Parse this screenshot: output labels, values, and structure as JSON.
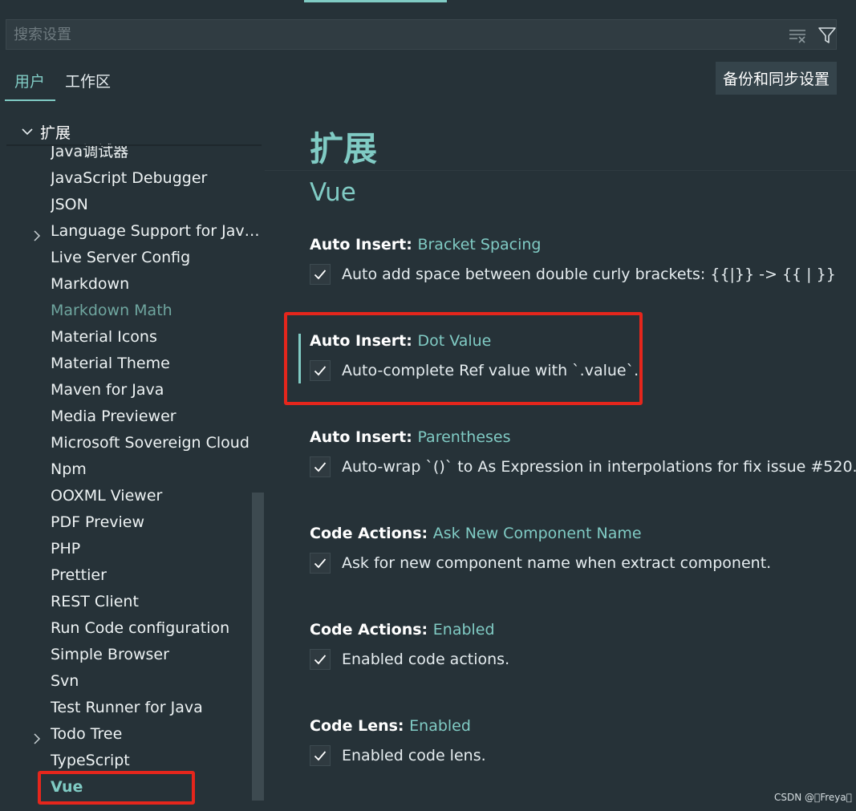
{
  "search": {
    "placeholder": "搜索设置"
  },
  "tabs": [
    {
      "label": "用户",
      "active": true
    },
    {
      "label": "工作区",
      "active": false
    }
  ],
  "sync_button": "备份和同步设置",
  "tree": {
    "header": "扩展",
    "items": [
      {
        "label": "Java调试器"
      },
      {
        "label": "JavaScript Debugger"
      },
      {
        "label": "JSON"
      },
      {
        "label": "Language Support for Java(T...",
        "expandable": true
      },
      {
        "label": "Live Server Config"
      },
      {
        "label": "Markdown"
      },
      {
        "label": "Markdown Math",
        "dim": true
      },
      {
        "label": "Material Icons"
      },
      {
        "label": "Material Theme"
      },
      {
        "label": "Maven for Java"
      },
      {
        "label": "Media Previewer"
      },
      {
        "label": "Microsoft Sovereign Cloud"
      },
      {
        "label": "Npm"
      },
      {
        "label": "OOXML Viewer"
      },
      {
        "label": "PDF Preview"
      },
      {
        "label": "PHP"
      },
      {
        "label": "Prettier"
      },
      {
        "label": "REST Client"
      },
      {
        "label": "Run Code configuration"
      },
      {
        "label": "Simple Browser"
      },
      {
        "label": "Svn"
      },
      {
        "label": "Test Runner for Java"
      },
      {
        "label": "Todo Tree",
        "expandable": true
      },
      {
        "label": "TypeScript"
      },
      {
        "label": "Vue",
        "selected": true
      }
    ]
  },
  "content": {
    "title": "扩展",
    "section": "Vue",
    "settings": [
      {
        "category": "Auto Insert: ",
        "name": "Bracket Spacing",
        "description": "Auto add space between double curly brackets: {{|}} -> {{ | }}",
        "checked": true
      },
      {
        "category": "Auto Insert: ",
        "name": "Dot Value",
        "description": "Auto-complete Ref value with `.value`.",
        "checked": true,
        "focused": true
      },
      {
        "category": "Auto Insert: ",
        "name": "Parentheses",
        "description": "Auto-wrap `()` to As Expression in interpolations for fix issue #520.",
        "checked": true
      },
      {
        "category": "Code Actions: ",
        "name": "Ask New Component Name",
        "description": "Ask for new component name when extract component.",
        "checked": true
      },
      {
        "category": "Code Actions: ",
        "name": "Enabled",
        "description": "Enabled code actions.",
        "checked": true
      },
      {
        "category": "Code Lens: ",
        "name": "Enabled",
        "description": "Enabled code lens.",
        "checked": true
      }
    ]
  },
  "watermark": "CSDN @\u0000Freya\u0000",
  "colors": {
    "background": "#263238",
    "accent": "#80cbc4",
    "highlight": "#e5261c"
  }
}
